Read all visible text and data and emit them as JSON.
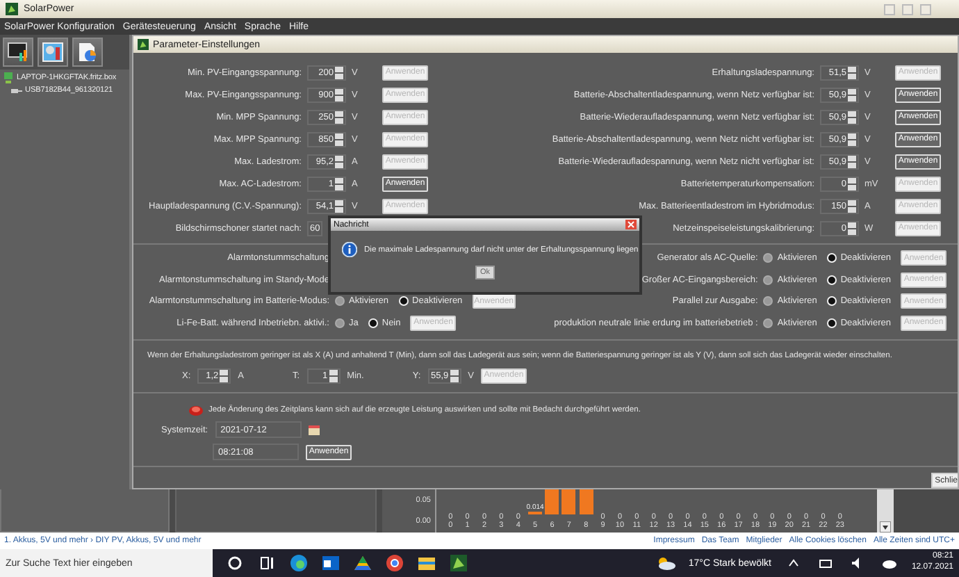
{
  "app": {
    "title": "SolarPower",
    "menu": [
      "SolarPower Konfiguration",
      "Gerätesteuerung",
      "Ansicht",
      "Sprache",
      "Hilfe"
    ]
  },
  "tree": {
    "label": "LAPTOP-1HKGFTAK.fritz.box",
    "children": [
      {
        "label": "USB7182B44_961320121"
      }
    ]
  },
  "dialog": {
    "title": "Parameter-Einstellungen",
    "left_params": [
      {
        "label": "Min. PV-Eingangsspannung:",
        "value": "200",
        "unit": "V",
        "apply": {
          "label": "Anwenden",
          "disabled": true
        }
      },
      {
        "label": "Max. PV-Eingangsspannung:",
        "value": "900",
        "unit": "V",
        "apply": {
          "label": "Anwenden",
          "disabled": true
        }
      },
      {
        "label": "Min. MPP Spannung:",
        "value": "250",
        "unit": "V",
        "apply": {
          "label": "Anwenden",
          "disabled": true
        }
      },
      {
        "label": "Max. MPP Spannung:",
        "value": "850",
        "unit": "V",
        "apply": {
          "label": "Anwenden",
          "disabled": true
        }
      },
      {
        "label": "Max. Ladestrom:",
        "value": "95,2",
        "unit": "A",
        "apply": {
          "label": "Anwenden",
          "disabled": true
        }
      },
      {
        "label": "Max. AC-Ladestrom:",
        "value": "1",
        "unit": "A",
        "apply": {
          "label": "Anwenden",
          "disabled": false
        }
      },
      {
        "label": "Hauptladespannung (C.V.-Spannung):",
        "value": "54,1",
        "unit": "V",
        "apply": {
          "label": "Anwenden",
          "disabled": true
        }
      },
      {
        "label": "Bildschirmschoner startet nach:",
        "value": "60"
      }
    ],
    "right_params": [
      {
        "label": "Erhaltungsladespannung:",
        "value": "51,5",
        "unit": "V",
        "apply": {
          "label": "Anwenden",
          "disabled": true
        }
      },
      {
        "label": "Batterie-Abschaltentladespannung, wenn Netz verfügbar ist:",
        "value": "50,9",
        "unit": "V",
        "apply": {
          "label": "Anwenden",
          "disabled": false
        }
      },
      {
        "label": "Batterie-Wiederaufladespannung, wenn Netz verfügbar ist:",
        "value": "50,9",
        "unit": "V",
        "apply": {
          "label": "Anwenden",
          "disabled": false
        }
      },
      {
        "label": "Batterie-Abschaltentladespannung, wenn Netz nicht verfügbar ist:",
        "value": "50,9",
        "unit": "V",
        "apply": {
          "label": "Anwenden",
          "disabled": false
        }
      },
      {
        "label": "Batterie-Wiederaufladespannung, wenn Netz nicht verfügbar ist:",
        "value": "50,9",
        "unit": "V",
        "apply": {
          "label": "Anwenden",
          "disabled": false
        }
      },
      {
        "label": "Batterietemperaturkompensation:",
        "value": "0",
        "unit": "mV",
        "apply": {
          "label": "Anwenden",
          "disabled": true
        }
      },
      {
        "label": "Max. Batterieentladestrom im Hybridmodus:",
        "value": "150",
        "unit": "A",
        "apply": {
          "label": "Anwenden",
          "disabled": true
        }
      },
      {
        "label": "Netzeinspeiseleistungskalibrierung:",
        "value": "0",
        "unit": "W",
        "apply": {
          "label": "Anwenden",
          "disabled": true
        }
      }
    ],
    "left_switches": [
      {
        "label": "Alarmtonstummschaltung"
      },
      {
        "label": "Alarmtonstummschaltung im Standy-Mode"
      },
      {
        "label": "Alarmtonstummschaltung im Batterie-Modus:",
        "options": [
          {
            "label": "Aktivieren",
            "selected": false
          },
          {
            "label": "Deaktivieren",
            "selected": true
          }
        ],
        "apply": {
          "label": "Anwenden",
          "disabled": true
        }
      },
      {
        "label": "Li-Fe-Batt. während Inbetriebn. aktivi.:",
        "options": [
          {
            "label": "Ja",
            "selected": false
          },
          {
            "label": "Nein",
            "selected": true
          }
        ],
        "apply": {
          "label": "Anwenden",
          "disabled": true
        }
      }
    ],
    "right_switches": [
      {
        "label": "Generator als AC-Quelle:",
        "options": [
          {
            "label": "Aktivieren",
            "selected": false
          },
          {
            "label": "Deaktivieren",
            "selected": true
          }
        ],
        "apply": {
          "label": "Anwenden",
          "disabled": true
        }
      },
      {
        "label": "Großer AC-Eingangsbereich:",
        "options": [
          {
            "label": "Aktivieren",
            "selected": false
          },
          {
            "label": "Deaktivieren",
            "selected": true
          }
        ],
        "apply": {
          "label": "Anwenden",
          "disabled": true
        }
      },
      {
        "label": "Parallel zur Ausgabe:",
        "options": [
          {
            "label": "Aktivieren",
            "selected": false
          },
          {
            "label": "Deaktivieren",
            "selected": true
          }
        ],
        "apply": {
          "label": "Anwenden",
          "disabled": true
        }
      },
      {
        "label": "produktion neutrale linie erdung im batteriebetrieb :",
        "options": [
          {
            "label": "Aktivieren",
            "selected": false
          },
          {
            "label": "Deaktivieren",
            "selected": true
          }
        ],
        "apply": {
          "label": "Anwenden",
          "disabled": true
        }
      }
    ],
    "float_charge": {
      "text": "Wenn der Erhaltungsladestrom geringer ist als X (A) und anhaltend T (Min), dann soll das Ladegerät aus sein; wenn die Batteriespannung geringer ist als Y (V), dann soll sich das Ladegerät wieder einschalten.",
      "fields": [
        {
          "label": "X:",
          "value": "1,2",
          "unit": "A"
        },
        {
          "label": "T:",
          "value": "1",
          "unit": "Min."
        },
        {
          "label": "Y:",
          "value": "55,9",
          "unit": "V"
        }
      ],
      "apply": {
        "label": "Anwenden",
        "disabled": true
      }
    },
    "schedule": {
      "warning": "Jede Änderung des Zeitplans kann sich auf die erzeugte Leistung auswirken und sollte mit Bedacht durchgeführt werden.",
      "time_label": "Systemzeit:",
      "date": "2021-07-12",
      "time": "08:21:08",
      "apply": {
        "label": "Anwenden",
        "disabled": false
      }
    },
    "close_button": "Schlie"
  },
  "message": {
    "title": "Nachricht",
    "text": "Die maximale Ladespannung darf nicht unter der Erhaltungsspannung liegen",
    "button": {
      "label": "Ok",
      "disabled": true
    }
  },
  "background_chart": {
    "y_labels": [
      "0.05",
      "0.00"
    ],
    "columns": [
      {
        "hour": "0",
        "kind": "zero",
        "value": "0"
      },
      {
        "hour": "1",
        "kind": "zero",
        "value": "0"
      },
      {
        "hour": "2",
        "kind": "zero",
        "value": "0"
      },
      {
        "hour": "3",
        "kind": "zero",
        "value": "0"
      },
      {
        "hour": "4",
        "kind": "zero",
        "value": "0"
      },
      {
        "hour": "5",
        "kind": "small",
        "value": "0.014"
      },
      {
        "hour": "6",
        "kind": "tall"
      },
      {
        "hour": "7",
        "kind": "tall"
      },
      {
        "hour": "8",
        "kind": "tall"
      },
      {
        "hour": "9",
        "kind": "zero",
        "value": "0"
      },
      {
        "hour": "10",
        "kind": "zero",
        "value": "0"
      },
      {
        "hour": "11",
        "kind": "zero",
        "value": "0"
      },
      {
        "hour": "12",
        "kind": "zero",
        "value": "0"
      },
      {
        "hour": "13",
        "kind": "zero",
        "value": "0"
      },
      {
        "hour": "14",
        "kind": "zero",
        "value": "0"
      },
      {
        "hour": "15",
        "kind": "zero",
        "value": "0"
      },
      {
        "hour": "16",
        "kind": "zero",
        "value": "0"
      },
      {
        "hour": "17",
        "kind": "zero",
        "value": "0"
      },
      {
        "hour": "18",
        "kind": "zero",
        "value": "0"
      },
      {
        "hour": "19",
        "kind": "zero",
        "value": "0"
      },
      {
        "hour": "20",
        "kind": "zero",
        "value": "0"
      },
      {
        "hour": "21",
        "kind": "zero",
        "value": "0"
      },
      {
        "hour": "22",
        "kind": "zero",
        "value": "0"
      },
      {
        "hour": "23",
        "kind": "zero",
        "value": "0"
      }
    ]
  },
  "browser_footer": {
    "breadcrumb": "1. Akkus, 5V und mehr › DIY PV, Akkus, 5V und mehr",
    "links": [
      "Impressum",
      "Das Team",
      "Mitglieder",
      "Alle Cookies löschen",
      "Alle Zeiten sind UTC+"
    ]
  },
  "taskbar": {
    "search_placeholder": "Zur Suche Text hier eingeben",
    "weather": "17°C Stark bewölkt",
    "time": "08:21",
    "date": "12.07.2021"
  }
}
